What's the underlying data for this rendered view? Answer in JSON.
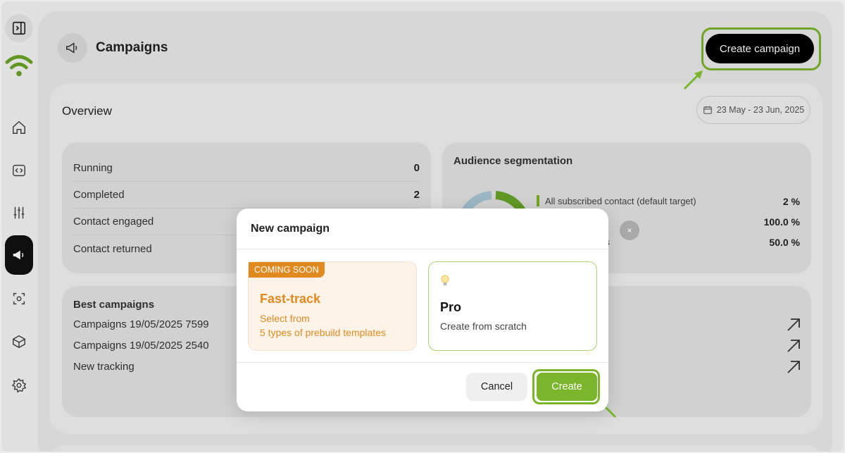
{
  "header": {
    "title": "Campaigns",
    "create_label": "Create campaign"
  },
  "overview": {
    "title": "Overview",
    "date_range": "23 May - 23 Jun, 2025"
  },
  "stats": [
    {
      "label": "Running",
      "value": "0"
    },
    {
      "label": "Completed",
      "value": "2"
    },
    {
      "label": "Contact engaged",
      "value": ""
    },
    {
      "label": "Contact returned",
      "value": ""
    }
  ],
  "audience": {
    "title": "Audience segmentation",
    "rows": [
      {
        "label": "All subscribed contact (default target)",
        "pct": "2 %"
      },
      {
        "label": "ns",
        "pct": "100.0 %"
      },
      {
        "label": "ions",
        "pct": "50.0 %"
      }
    ]
  },
  "best": {
    "title": "Best campaigns",
    "items": [
      "Campaigns 19/05/2025 7599",
      "Campaigns 19/05/2025 2540",
      "New tracking"
    ]
  },
  "modal": {
    "title": "New campaign",
    "fast": {
      "badge": "COMING SOON",
      "title": "Fast-track",
      "desc_line1": "Select from",
      "desc_line2": "5 types of prebuild templates"
    },
    "pro": {
      "title": "Pro",
      "desc": "Create from scratch"
    },
    "cancel_label": "Cancel",
    "create_label": "Create",
    "close_glyph": "×"
  },
  "colors": {
    "accent": "#7ab52b",
    "warning": "#e08a20"
  }
}
